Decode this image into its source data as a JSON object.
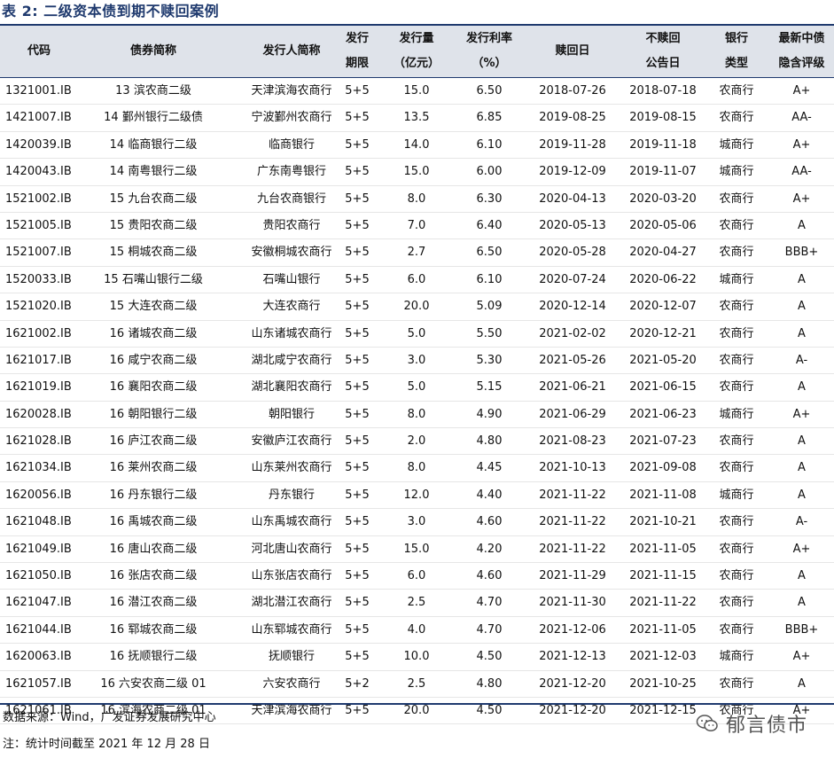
{
  "title": "表 2:  二级资本债到期不赎回案例",
  "headers": [
    {
      "line1": "代码",
      "line2": ""
    },
    {
      "line1": "债券简称",
      "line2": ""
    },
    {
      "line1": "发行人简称",
      "line2": ""
    },
    {
      "line1": "发行",
      "line2": "期限"
    },
    {
      "line1": "发行量",
      "line2": "（亿元）"
    },
    {
      "line1": "发行利率",
      "line2": "（%）"
    },
    {
      "line1": "赎回日",
      "line2": ""
    },
    {
      "line1": "不赎回",
      "line2": "公告日"
    },
    {
      "line1": "银行",
      "line2": "类型"
    },
    {
      "line1": "最新中债",
      "line2": "隐含评级"
    }
  ],
  "rows": [
    [
      "1321001.IB",
      "13 滨农商二级",
      "天津滨海农商行",
      "5+5",
      "15.0",
      "6.50",
      "2018-07-26",
      "2018-07-18",
      "农商行",
      "A+"
    ],
    [
      "1421007.IB",
      "14 鄞州银行二级债",
      "宁波鄞州农商行",
      "5+5",
      "13.5",
      "6.85",
      "2019-08-25",
      "2019-08-15",
      "农商行",
      "AA-"
    ],
    [
      "1420039.IB",
      "14 临商银行二级",
      "临商银行",
      "5+5",
      "14.0",
      "6.10",
      "2019-11-28",
      "2019-11-18",
      "城商行",
      "A+"
    ],
    [
      "1420043.IB",
      "14 南粤银行二级",
      "广东南粤银行",
      "5+5",
      "15.0",
      "6.00",
      "2019-12-09",
      "2019-11-07",
      "城商行",
      "AA-"
    ],
    [
      "1521002.IB",
      "15 九台农商二级",
      "九台农商银行",
      "5+5",
      "8.0",
      "6.30",
      "2020-04-13",
      "2020-03-20",
      "农商行",
      "A+"
    ],
    [
      "1521005.IB",
      "15 贵阳农商二级",
      "贵阳农商行",
      "5+5",
      "7.0",
      "6.40",
      "2020-05-13",
      "2020-05-06",
      "农商行",
      "A"
    ],
    [
      "1521007.IB",
      "15 桐城农商二级",
      "安徽桐城农商行",
      "5+5",
      "2.7",
      "6.50",
      "2020-05-28",
      "2020-04-27",
      "农商行",
      "BBB+"
    ],
    [
      "1520033.IB",
      "15 石嘴山银行二级",
      "石嘴山银行",
      "5+5",
      "6.0",
      "6.10",
      "2020-07-24",
      "2020-06-22",
      "城商行",
      "A"
    ],
    [
      "1521020.IB",
      "15 大连农商二级",
      "大连农商行",
      "5+5",
      "20.0",
      "5.09",
      "2020-12-14",
      "2020-12-07",
      "农商行",
      "A"
    ],
    [
      "1621002.IB",
      "16 诸城农商二级",
      "山东诸城农商行",
      "5+5",
      "5.0",
      "5.50",
      "2021-02-02",
      "2020-12-21",
      "农商行",
      "A"
    ],
    [
      "1621017.IB",
      "16 咸宁农商二级",
      "湖北咸宁农商行",
      "5+5",
      "3.0",
      "5.30",
      "2021-05-26",
      "2021-05-20",
      "农商行",
      "A-"
    ],
    [
      "1621019.IB",
      "16 襄阳农商二级",
      "湖北襄阳农商行",
      "5+5",
      "5.0",
      "5.15",
      "2021-06-21",
      "2021-06-15",
      "农商行",
      "A"
    ],
    [
      "1620028.IB",
      "16 朝阳银行二级",
      "朝阳银行",
      "5+5",
      "8.0",
      "4.90",
      "2021-06-29",
      "2021-06-23",
      "城商行",
      "A+"
    ],
    [
      "1621028.IB",
      "16 庐江农商二级",
      "安徽庐江农商行",
      "5+5",
      "2.0",
      "4.80",
      "2021-08-23",
      "2021-07-23",
      "农商行",
      "A"
    ],
    [
      "1621034.IB",
      "16 莱州农商二级",
      "山东莱州农商行",
      "5+5",
      "8.0",
      "4.45",
      "2021-10-13",
      "2021-09-08",
      "农商行",
      "A"
    ],
    [
      "1620056.IB",
      "16 丹东银行二级",
      "丹东银行",
      "5+5",
      "12.0",
      "4.40",
      "2021-11-22",
      "2021-11-08",
      "城商行",
      "A"
    ],
    [
      "1621048.IB",
      "16 禹城农商二级",
      "山东禹城农商行",
      "5+5",
      "3.0",
      "4.60",
      "2021-11-22",
      "2021-10-21",
      "农商行",
      "A-"
    ],
    [
      "1621049.IB",
      "16 唐山农商二级",
      "河北唐山农商行",
      "5+5",
      "15.0",
      "4.20",
      "2021-11-22",
      "2021-11-05",
      "农商行",
      "A+"
    ],
    [
      "1621050.IB",
      "16 张店农商二级",
      "山东张店农商行",
      "5+5",
      "6.0",
      "4.60",
      "2021-11-29",
      "2021-11-15",
      "农商行",
      "A"
    ],
    [
      "1621047.IB",
      "16 潜江农商二级",
      "湖北潜江农商行",
      "5+5",
      "2.5",
      "4.70",
      "2021-11-30",
      "2021-11-22",
      "农商行",
      "A"
    ],
    [
      "1621044.IB",
      "16 郓城农商二级",
      "山东郓城农商行",
      "5+5",
      "4.0",
      "4.70",
      "2021-12-06",
      "2021-11-05",
      "农商行",
      "BBB+"
    ],
    [
      "1620063.IB",
      "16 抚顺银行二级",
      "抚顺银行",
      "5+5",
      "10.0",
      "4.50",
      "2021-12-13",
      "2021-12-03",
      "城商行",
      "A+"
    ],
    [
      "1621057.IB",
      "16 六安农商二级 01",
      "六安农商行",
      "5+2",
      "2.5",
      "4.80",
      "2021-12-20",
      "2021-10-25",
      "农商行",
      "A"
    ],
    [
      "1621061.IB",
      "16 滨海农商二级 01",
      "天津滨海农商行",
      "5+5",
      "20.0",
      "4.50",
      "2021-12-20",
      "2021-12-15",
      "农商行",
      "A+"
    ]
  ],
  "source": "数据来源：Wind，广发证券发展研究中心",
  "note": "注：统计时间截至 2021 年 12 月 28 日",
  "watermark": "郁言债市",
  "colors": {
    "accent": "#1f3a6e",
    "header_bg": "#dfe3ea"
  }
}
